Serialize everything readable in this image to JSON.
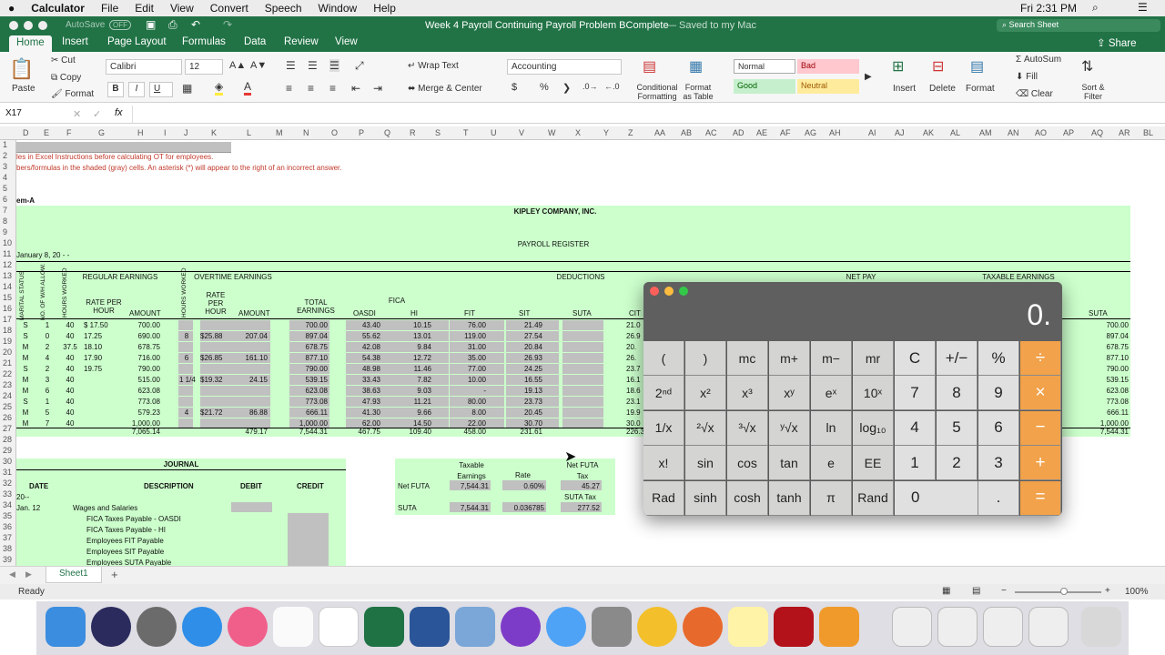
{
  "menubar": {
    "app": "Calculator",
    "items": [
      "File",
      "Edit",
      "View",
      "Convert",
      "Speech",
      "Window",
      "Help"
    ],
    "clock": "Fri 2:31 PM"
  },
  "window": {
    "autosave": "AutoSave",
    "autosave_state": "OFF",
    "title": "Week 4 Payroll Continuing Payroll Problem BComplete",
    "saved": "— Saved to my Mac",
    "search_placeholder": "Search Sheet"
  },
  "ribbon": {
    "tabs": [
      "Home",
      "Insert",
      "Page Layout",
      "Formulas",
      "Data",
      "Review",
      "View"
    ],
    "share": "Share",
    "paste": "Paste",
    "cut": "Cut",
    "copy": "Copy",
    "format_painter": "Format",
    "font": "Calibri",
    "size": "12",
    "bold": "B",
    "italic": "I",
    "underline": "U",
    "wrap": "Wrap Text",
    "merge": "Merge & Center",
    "numfmt": "Accounting",
    "dollar": "$",
    "pct": "%",
    "comma": "❯",
    "cond_fmt": "Conditional Formatting",
    "fmt_table": "Format as Table",
    "styles": {
      "normal": "Normal",
      "bad": "Bad",
      "good": "Good",
      "neutral": "Neutral"
    },
    "insert": "Insert",
    "delete": "Delete",
    "format": "Format",
    "autosum": "AutoSum",
    "fill": "Fill",
    "clear": "Clear",
    "sort": "Sort & Filter"
  },
  "formula": {
    "name_box": "X17",
    "fx": "fx"
  },
  "columns": [
    "D",
    "E",
    "F",
    "G",
    "H",
    "I",
    "J",
    "K",
    "L",
    "M",
    "N",
    "O",
    "P",
    "Q",
    "R",
    "S",
    "T",
    "U",
    "V",
    "W",
    "X",
    "Y",
    "Z",
    "AA",
    "AB",
    "AC",
    "AD",
    "AE",
    "AF",
    "AG",
    "AH",
    "AI",
    "AJ",
    "AK",
    "AL",
    "AM",
    "AN",
    "AO",
    "AP",
    "AQ",
    "AR",
    "BL"
  ],
  "rows": [
    "1",
    "2",
    "3",
    "4",
    "5",
    "6",
    "7",
    "8",
    "9",
    "10",
    "11",
    "12",
    "13",
    "14",
    "15",
    "16",
    "17",
    "18",
    "19",
    "20",
    "21",
    "22",
    "23",
    "24",
    "25",
    "26",
    "27",
    "28",
    "29",
    "30",
    "31",
    "32",
    "33",
    "34",
    "35",
    "36",
    "37",
    "38",
    "39"
  ],
  "sheet": {
    "note1": "les in Excel Instructions before calculating OT for employees.",
    "note2": "bers/formulas in the shaded (gray) cells. An asterisk (*) will appear to the right of an incorrect answer.",
    "item": "em-A",
    "company": "KIPLEY COMPANY, INC.",
    "register": "PAYROLL REGISTER",
    "date": "January 8, 20 - -",
    "h_regular": "REGULAR EARNINGS",
    "h_overtime": "OVERTIME EARNINGS",
    "h_deductions": "DEDUCTIONS",
    "h_netpay": "NET PAY",
    "h_taxable": "TAXABLE EARNINGS",
    "h_marital": "MARITAL STATUS",
    "h_allow": "NO. OF W/H ALLOW.",
    "h_hours": "HOURS WORKED",
    "h_rate": "RATE PER HOUR",
    "h_amount": "AMOUNT",
    "h_ot_hours": "HOURS WORKED",
    "h_ot_rate": "RATE PER HOUR",
    "h_ot_amount": "AMOUNT",
    "h_total": "TOTAL EARNINGS",
    "h_fica": "FICA",
    "h_oasdi": "OASDI",
    "h_hi": "HI",
    "h_fit": "FIT",
    "h_sit": "SIT",
    "h_suta": "SUTA",
    "h_cit": "CIT",
    "h_suta2": "SUTA",
    "payroll": [
      [
        "S",
        "1",
        "40",
        "$ 17.50",
        "700.00",
        "",
        "",
        "",
        "700.00",
        "43.40",
        "10.15",
        "76.00",
        "21.49",
        "21.0",
        "700.00"
      ],
      [
        "S",
        "0",
        "40",
        "17.25",
        "690.00",
        "8",
        "$25.88",
        "207.04",
        "897.04",
        "55.62",
        "13.01",
        "119.00",
        "27.54",
        "26.9",
        "897.04"
      ],
      [
        "M",
        "2",
        "37.5",
        "18.10",
        "678.75",
        "",
        "",
        "",
        "678.75",
        "42.08",
        "9.84",
        "31.00",
        "20.84",
        "20.",
        "678.75"
      ],
      [
        "M",
        "4",
        "40",
        "17.90",
        "716.00",
        "6",
        "$26.85",
        "161.10",
        "877.10",
        "54.38",
        "12.72",
        "35.00",
        "26.93",
        "26.",
        "877.10"
      ],
      [
        "S",
        "2",
        "40",
        "19.75",
        "790.00",
        "",
        "",
        "",
        "790.00",
        "48.98",
        "11.46",
        "77.00",
        "24.25",
        "23.7",
        "790.00"
      ],
      [
        "M",
        "3",
        "40",
        "",
        "515.00",
        "1 1/4",
        "$19.32",
        "24.15",
        "539.15",
        "33.43",
        "7.82",
        "10.00",
        "16.55",
        "16.1",
        "539.15"
      ],
      [
        "M",
        "6",
        "40",
        "",
        "623.08",
        "",
        "",
        "",
        "623.08",
        "38.63",
        "9.03",
        "-",
        "19.13",
        "18.6",
        "623.08"
      ],
      [
        "S",
        "1",
        "40",
        "",
        "773.08",
        "",
        "",
        "",
        "773.08",
        "47.93",
        "11.21",
        "80.00",
        "23.73",
        "23.1",
        "773.08"
      ],
      [
        "M",
        "5",
        "40",
        "",
        "579.23",
        "4",
        "$21.72",
        "86.88",
        "666.11",
        "41.30",
        "9.66",
        "8.00",
        "20.45",
        "19.9",
        "666.11"
      ],
      [
        "M",
        "7",
        "40",
        "",
        "1,000.00",
        "",
        "",
        "",
        "1,000.00",
        "62.00",
        "14.50",
        "22.00",
        "30.70",
        "30.0",
        "1,000.00"
      ]
    ],
    "totals": [
      "7,065.14",
      "479.17",
      "7,544.31",
      "467.75",
      "109.40",
      "458.00",
      "231.61",
      "226.3",
      "7,544.31"
    ],
    "journal": "JOURNAL",
    "j_date": "DATE",
    "j_desc": "DESCRIPTION",
    "j_debit": "DEBIT",
    "j_credit": "CREDIT",
    "j_year": "20--",
    "j_day": "Jan.  12",
    "j_lines": [
      "Wages and Salaries",
      "FICA Taxes Payable - OASDI",
      "FICA Taxes Payable - HI",
      "Employees FIT Payable",
      "Employees SIT Payable",
      "Employees SUTA Payable"
    ],
    "fut_taxable": "Taxable Earnings",
    "fut_rate": "Rate",
    "fut_net": "Net FUTA Tax",
    "suta_tax": "SUTA Tax",
    "futa_label": "Net FUTA",
    "futa_earn": "7,544.31",
    "futa_rate": "0.60%",
    "futa_tax": "45.27",
    "suta_label": "SUTA",
    "suta_earn": "7,544.31",
    "suta_rate": "0.036785",
    "suta_amt": "277.52"
  },
  "sheet_tab": "Sheet1",
  "status": "Ready",
  "zoom": "100%",
  "calculator": {
    "display": "0.",
    "keys": [
      [
        "(",
        ")",
        "mc",
        "m+",
        "m−",
        "mr",
        "C",
        "+/−",
        "%",
        "÷"
      ],
      [
        "2ⁿᵈ",
        "x²",
        "x³",
        "xʸ",
        "eˣ",
        "10ˣ",
        "7",
        "8",
        "9",
        "×"
      ],
      [
        "1/x",
        "²√x",
        "³√x",
        "ʸ√x",
        "ln",
        "log₁₀",
        "4",
        "5",
        "6",
        "−"
      ],
      [
        "x!",
        "sin",
        "cos",
        "tan",
        "e",
        "EE",
        "1",
        "2",
        "3",
        "+"
      ],
      [
        "Rad",
        "sinh",
        "cosh",
        "tanh",
        "π",
        "Rand",
        "0",
        "",
        ".",
        "="
      ]
    ]
  },
  "colors": {
    "excel_green": "#217346",
    "sheet_green": "#ccffcc",
    "gray_cell": "#c0c0c0",
    "calc_orange": "#f1a24a"
  }
}
